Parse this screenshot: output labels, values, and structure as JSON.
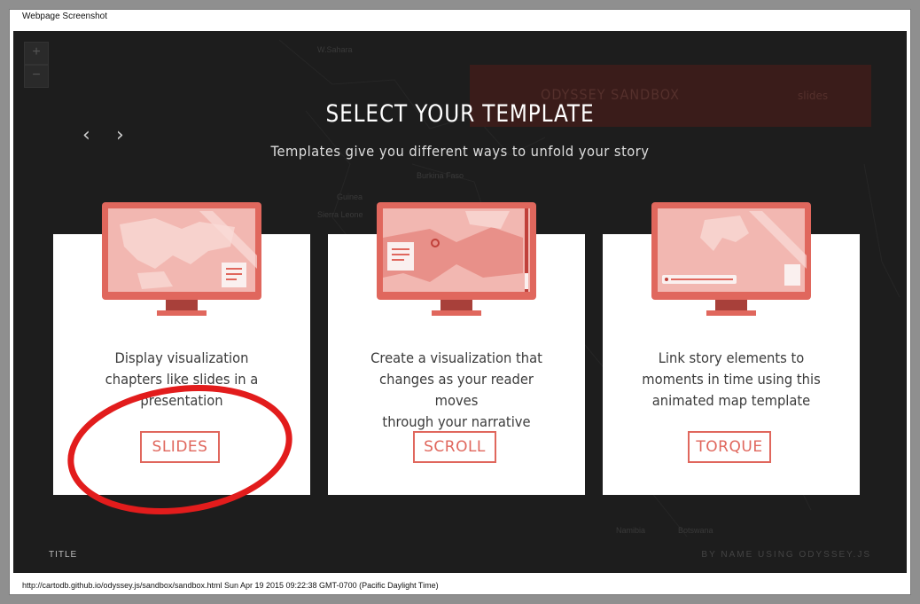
{
  "capture": {
    "header": "Webpage Screenshot",
    "footer": "http://cartodb.github.io/odyssey.js/sandbox/sandbox.html Sun Apr 19 2015 09:22:38 GMT-0700 (Pacific Daylight Time)"
  },
  "background_app": {
    "zoom_in": "+",
    "zoom_out": "−",
    "nav_prev": "‹",
    "nav_next": "›",
    "panel_title": "ODYSSEY SANDBOX",
    "panel_mode": "slides",
    "bottom_title": "TITLE",
    "byline": "BY NAME USING ODYSSEY.JS",
    "map_labels": [
      "W.Sahara",
      "Burkina Faso",
      "Guinea",
      "Sierra Leone",
      "Namibia",
      "Botswana"
    ]
  },
  "modal": {
    "title": "SELECT YOUR TEMPLATE",
    "subtitle": "Templates give you different ways to unfold your story",
    "cards": [
      {
        "description_lines": [
          "Display visualization",
          "chapters like slides in a",
          "presentation"
        ],
        "button": "SLIDES"
      },
      {
        "description_lines": [
          "Create a visualization that",
          "changes as your reader moves",
          "through your narrative"
        ],
        "button": "SCROLL"
      },
      {
        "description_lines": [
          "Link story elements to",
          "moments in time using this",
          "animated map template"
        ],
        "button": "TORQUE"
      }
    ]
  },
  "colors": {
    "accent": "#e0675d",
    "overlay": "#1d1d1d",
    "card": "#ffffff",
    "highlight": "#e21c1c"
  }
}
